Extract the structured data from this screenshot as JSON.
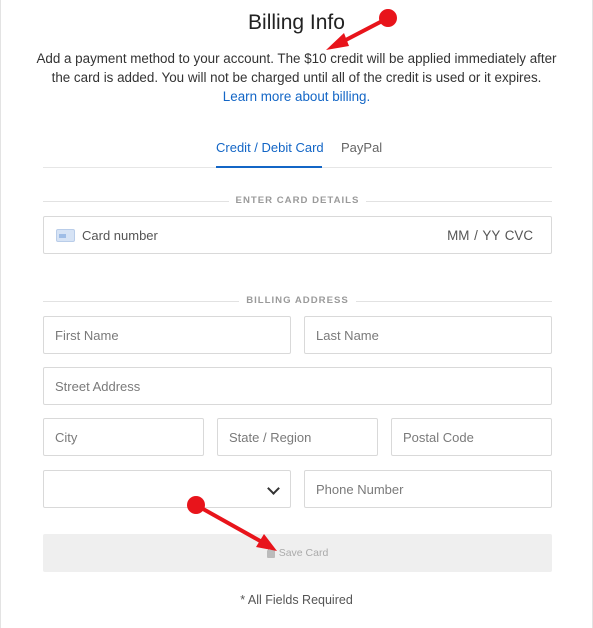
{
  "header": {
    "title": "Billing Info",
    "description": "Add a payment method to your account. The $10 credit will be applied immediately after the card is added. You will not be charged until all of the credit is used or it expires.",
    "learn_more": "Learn more about billing."
  },
  "tabs": [
    {
      "label": "Credit / Debit Card",
      "active": true
    },
    {
      "label": "PayPal",
      "active": false
    }
  ],
  "card_section": {
    "heading": "ENTER CARD DETAILS",
    "card_number_placeholder": "Card number",
    "expiry_cvc_placeholder": "MM / YY  CVC",
    "icon": "credit-card-icon"
  },
  "billing_section": {
    "heading": "BILLING ADDRESS",
    "first_name": "First Name",
    "last_name": "Last Name",
    "street": "Street Address",
    "city": "City",
    "state": "State / Region",
    "postal": "Postal Code",
    "country_value": "",
    "phone": "Phone Number"
  },
  "actions": {
    "save_label": "Save Card",
    "save_icon": "lock-icon",
    "required_note": "* All Fields Required"
  },
  "colors": {
    "accent": "#1366c6",
    "annotation": "#e8141b"
  }
}
